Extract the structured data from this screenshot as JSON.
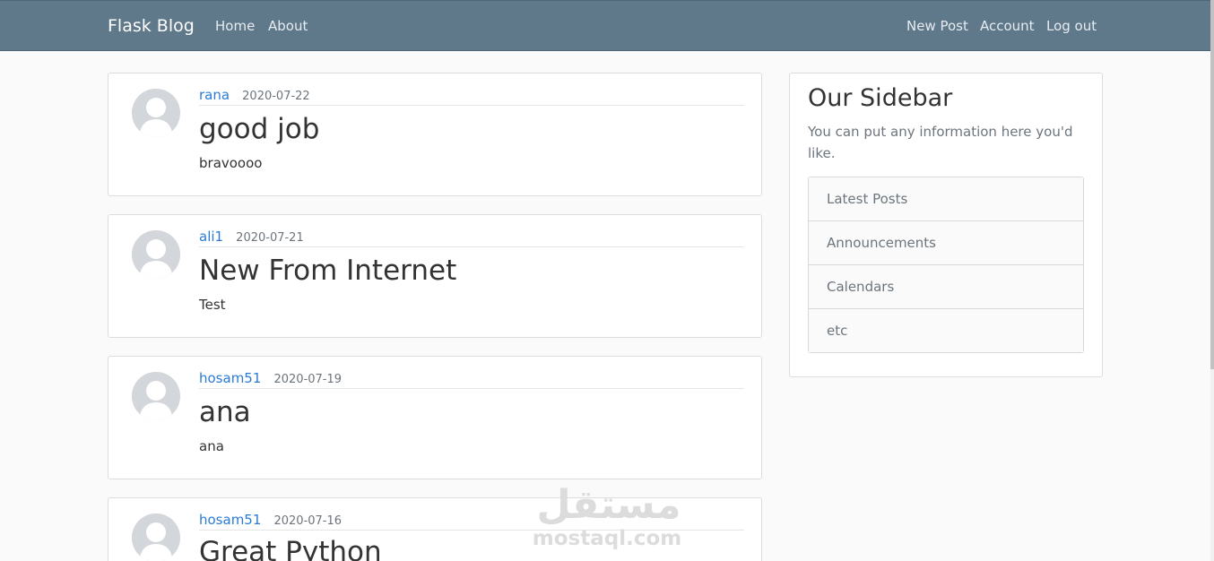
{
  "navbar": {
    "brand": "Flask Blog",
    "left_links": [
      "Home",
      "About"
    ],
    "right_links": [
      "New Post",
      "Account",
      "Log out"
    ]
  },
  "posts": [
    {
      "author": "rana",
      "date": "2020-07-22",
      "title": "good job",
      "content": "bravoooo"
    },
    {
      "author": "ali1",
      "date": "2020-07-21",
      "title": "New From Internet",
      "content": "Test"
    },
    {
      "author": "hosam51",
      "date": "2020-07-19",
      "title": "ana",
      "content": "ana"
    },
    {
      "author": "hosam51",
      "date": "2020-07-16",
      "title": "Great Python",
      "content": ""
    }
  ],
  "sidebar": {
    "title": "Our Sidebar",
    "text": "You can put any information here you'd like.",
    "items": [
      "Latest Posts",
      "Announcements",
      "Calendars",
      "etc"
    ]
  },
  "watermark": {
    "arabic": "مستقل",
    "latin": "mostaql.com"
  },
  "colors": {
    "navbar": "#5f788a",
    "link": "#2b7bd4"
  }
}
